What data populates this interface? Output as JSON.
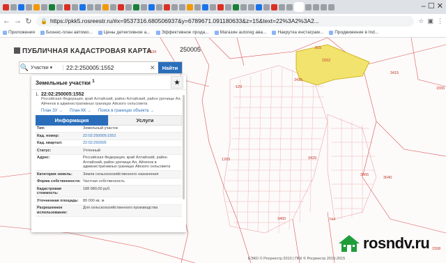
{
  "browser": {
    "url": "https://pkk5.rosreestr.ru/#x=9537316.680506937&y=6789671.091180633&z=15&text=22%3A2%3A2...",
    "back_icon": "arrow-left-icon",
    "forward_icon": "arrow-right-icon",
    "reload_icon": "reload-icon",
    "bookmarks": [
      "Приложения",
      "Бизнес-план автомо...",
      "Цены детективное а...",
      "Эффективное прода...",
      "Магазин autoreg ава...",
      "Накрутка инстаграм...",
      "Продвижение в Ind..."
    ]
  },
  "app": {
    "title": "ПУБЛИЧНАЯ КАДАСТРОВАЯ КАРТА"
  },
  "search": {
    "type": "Участки",
    "value": "22:2:250005:1552",
    "button": "Найти"
  },
  "panel": {
    "header": "Земельные участки",
    "count": "1",
    "object": {
      "num": "1.",
      "id": "22:02:250005:1552",
      "address": "Российская Федерация, край Алтайский, район Алтайский, район урочище Ая, Айченок в административных границах Айского сельсовета"
    },
    "links": [
      "План ЗУ →",
      "План КК →",
      "Поиск в границах объекта →"
    ],
    "tabs": [
      "Информация",
      "Услуги"
    ],
    "rows": [
      {
        "k": "Тип:",
        "v": "Земельный участок",
        "link": false
      },
      {
        "k": "Кад. номер:",
        "v": "22:02:250005:1552",
        "link": true
      },
      {
        "k": "Кад. квартал:",
        "v": "22:02:250005",
        "link": true
      },
      {
        "k": "Статус:",
        "v": "Учтенный",
        "link": false
      },
      {
        "k": "Адрес:",
        "v": "Российская Федерация, край Алтайский, район Алтайский, район урочище Ая, Айченок в административных границах Айского сельсовета",
        "link": false
      },
      {
        "k": "Категория земель:",
        "v": "Земли сельскохозяйственного назначения",
        "link": false
      },
      {
        "k": "Форма собственности:",
        "v": "Частная собственность",
        "link": false
      },
      {
        "k": "Кадастровая стоимость:",
        "v": "188 680,00 руб.",
        "link": false
      },
      {
        "k": "Уточненная площадь:",
        "v": "89 000 кв. м",
        "link": false
      },
      {
        "k": "Разрешенное использование:",
        "v": "Для сельскохозяйственного производства",
        "link": false
      }
    ]
  },
  "map": {
    "labels": [
      "250005",
      "2534",
      "815",
      "1552",
      "3425",
      "129",
      "3429",
      "3065",
      "3040",
      "1269",
      "3460",
      "744",
      "3415",
      "1555",
      "1558"
    ]
  },
  "footer": "ЕЭКО © Росреестр 2010 | ПКК © Росреестр 2010-2015",
  "watermark": "rosndv.ru"
}
